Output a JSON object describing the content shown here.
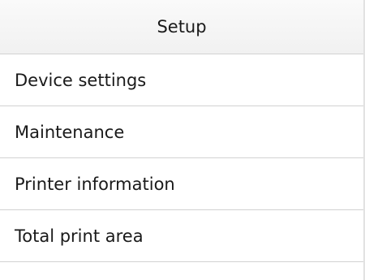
{
  "header": {
    "title": "Setup"
  },
  "menu": {
    "items": [
      {
        "label": "Device settings"
      },
      {
        "label": "Maintenance"
      },
      {
        "label": "Printer information"
      },
      {
        "label": "Total print area"
      }
    ]
  }
}
